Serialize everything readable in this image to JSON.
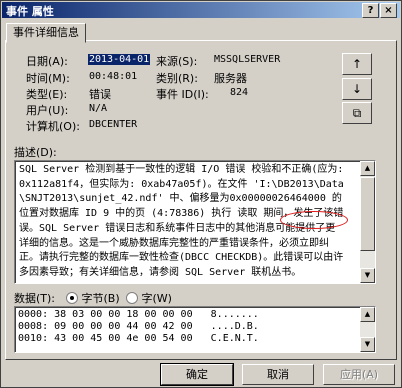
{
  "window": {
    "title": "事件 属性",
    "help_label": "?",
    "close_label": "×"
  },
  "tab": {
    "label": "事件详细信息"
  },
  "fields": {
    "date_label": "日期(A):",
    "date_value": "2013-04-01",
    "source_label": "来源(S):",
    "source_value": "MSSQLSERVER",
    "time_label": "时间(M):",
    "time_value": "00:48:01",
    "category_label": "类别(R):",
    "category_value": "服务器",
    "type_label": "类型(E):",
    "type_value": "错误",
    "eventid_label": "事件 ID(I):",
    "eventid_value": "824",
    "user_label": "用户(U):",
    "user_value": "N/A",
    "computer_label": "计算机(O):",
    "computer_value": "DBCENTER"
  },
  "side_buttons": {
    "up": "↑",
    "down": "↓",
    "copy": "⧉"
  },
  "description": {
    "label": "描述(D):",
    "before": "SQL Server 检测到基于一致性的逻辑 I/O 错误 校验和不正确(应为: 0x112a81f4，但实际为: 0xab47a05f)。在文件 'I:\\DB2013\\Data\\SNJT2013\\sunjet_42.ndf' 中、",
    "highlight": "偏移量为",
    "after": "0x00000026464000 的位置对数据库 ID 9 中的页 (4:78386) 执行 读取 期间，发生了该错误。SQL Server 错误日志和系统事件日志中的其他消息可能提供了更详细的信息。这是一个威胁数据库完整性的严重错误条件，必须立即纠正。请执行完整的数据库一致性检查(DBCC CHECKDB)。此错误可以由许多因素导致；有关详细信息，请参阅 SQL Server 联机丛书。"
  },
  "data_section": {
    "label": "数据(T):",
    "bytes_label": "字节(B)",
    "words_label": "字(W)",
    "selected": "bytes",
    "rows": [
      "0000: 38 03 00 00 18 00 00 00   8.......",
      "0008: 09 00 00 00 44 00 42 00   ....D.B.",
      "0010: 43 00 45 00 4e 00 54 00   C.E.N.T."
    ]
  },
  "buttons": {
    "ok": "确定",
    "cancel": "取消",
    "apply": "应用(A)"
  }
}
